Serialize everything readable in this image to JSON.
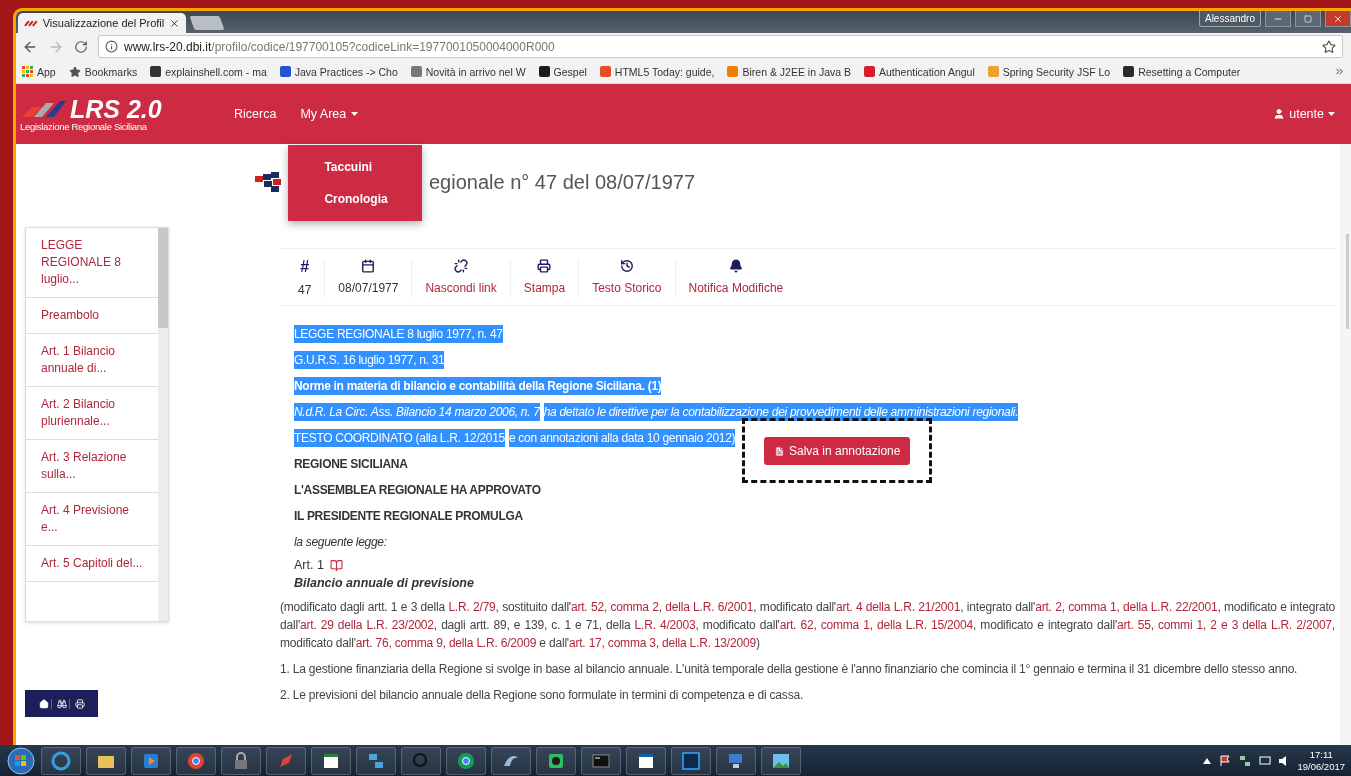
{
  "browser": {
    "tab": {
      "title": "Visualizzazione del Profil"
    },
    "profile": "Alessandro",
    "url": {
      "host": "www.lrs-20.dbi.it",
      "path": "/profilo/codice/197700105?codiceLink=1977001050004000R000"
    },
    "bookmarks": [
      {
        "label": "App",
        "kind": "apps"
      },
      {
        "label": "Bookmarks",
        "kind": "star"
      },
      {
        "label": "explainshell.com - ma",
        "kind": "site",
        "color": "#333333"
      },
      {
        "label": "Java Practices -> Cho",
        "kind": "site",
        "color": "#2255cc"
      },
      {
        "label": "Novità in arrivo nel W",
        "kind": "site",
        "color": "#777777"
      },
      {
        "label": "Gespel",
        "kind": "site",
        "color": "#1a1a1a"
      },
      {
        "label": "HTML5 Today: guide,",
        "kind": "site",
        "color": "#e44d26"
      },
      {
        "label": "Biren & J2EE in Java B",
        "kind": "site",
        "color": "#f57d00"
      },
      {
        "label": "Authentication Angul",
        "kind": "site",
        "color": "#d21f2a"
      },
      {
        "label": "Spring Security JSF Lo",
        "kind": "site",
        "color": "#f0a030"
      },
      {
        "label": "Resetting a Computer",
        "kind": "site",
        "color": "#2a2a2a"
      }
    ]
  },
  "navbar": {
    "logo": {
      "title": "LRS 2.0",
      "subtitle": "Legislazione Regionale Siciliana"
    },
    "items": [
      {
        "label": "Ricerca"
      },
      {
        "label": "My Area",
        "menu": [
          "Taccuini",
          "Cronologia"
        ]
      }
    ],
    "user": "utente"
  },
  "sidebar": {
    "items": [
      "LEGGE REGIONALE 8 luglio...",
      "Preambolo",
      "Art. 1 Bilancio annuale di...",
      "Art. 2 Bilancio pluriennale...",
      "Art. 3 Relazione sulla...",
      "Art. 4 Previsione e...",
      "Art. 5 Capitoli del..."
    ]
  },
  "document": {
    "title": "egionale n° 47 del 08/07/1977",
    "toolbar": [
      {
        "kind": "number",
        "symbol": "#",
        "label": "47",
        "link": false
      },
      {
        "kind": "date",
        "label": "08/07/1977",
        "link": false
      },
      {
        "kind": "unlink",
        "label": "Nascondi link",
        "link": true
      },
      {
        "kind": "print",
        "label": "Stampa",
        "link": true
      },
      {
        "kind": "history",
        "label": "Testo Storico",
        "link": true
      },
      {
        "kind": "bell",
        "label": "Notifica Modifiche",
        "link": true
      }
    ],
    "lines": [
      {
        "kind": "reference",
        "highlighted": true,
        "segments": [
          "LEGGE REGIONALE 8 luglio 1977, n. 47"
        ]
      },
      {
        "kind": "reference",
        "highlighted": true,
        "segments": [
          "G.U.R.S. 16 luglio 1977, n. 31"
        ]
      },
      {
        "kind": "subject",
        "highlighted": true,
        "segments": [
          "Norme in materia di bilancio e contabilità della Regione Siciliana. (1)"
        ]
      },
      {
        "kind": "note",
        "highlighted": true,
        "segments": [
          "N.d.R. La Circ. Ass. Bilancio 14 marzo 2006, n. 7",
          "ha dettato le direttive per la contabilizzazione dei provvedimenti delle amministrazioni regionali."
        ]
      },
      {
        "kind": "reference",
        "highlighted": true,
        "segments": [
          "TESTO COORDINATO (alla L.R. 12/2015",
          "e con annotazioni alla data 10 gennaio 2012)"
        ]
      },
      {
        "kind": "heading",
        "highlighted": false,
        "segments": [
          "REGIONE SICILIANA"
        ]
      },
      {
        "kind": "heading",
        "highlighted": false,
        "segments": [
          "L'ASSEMBLEA REGIONALE HA APPROVATO"
        ]
      },
      {
        "kind": "heading",
        "highlighted": false,
        "segments": [
          "IL PRESIDENTE REGIONALE PROMULGA"
        ]
      },
      {
        "kind": "formula",
        "highlighted": false,
        "segments": [
          "la seguente legge:"
        ]
      }
    ],
    "save_button": "Salva in annotazione",
    "article": {
      "number": "Art. 1",
      "title": "Bilancio annuale di previsione",
      "note": [
        {
          "text": "(modificato dagli artt. 1 e 3 della ",
          "kind": "text"
        },
        {
          "text": "L.R. 2/79",
          "kind": "link"
        },
        {
          "text": ", sostituito dall'",
          "kind": "text"
        },
        {
          "text": "art. 52, comma 2, della L.R. 6/2001",
          "kind": "link"
        },
        {
          "text": ", modificato dall'",
          "kind": "text"
        },
        {
          "text": "art. 4 della L.R. 21/2001",
          "kind": "link"
        },
        {
          "text": ", integrato dall'",
          "kind": "text"
        },
        {
          "text": "art. 2, comma 1, della L.R.",
          "kind": "link"
        },
        {
          "text": "22/2001",
          "kind": "link"
        },
        {
          "text": ", modificato e integrato dall'",
          "kind": "text"
        },
        {
          "text": "art. 29 della L.R. 23/2002",
          "kind": "link"
        },
        {
          "text": ", dagli artt. 89, e 139, c. 1 e 71, della ",
          "kind": "text"
        },
        {
          "text": "L.R. 4/2003",
          "kind": "link"
        },
        {
          "text": ", modificato dall'",
          "kind": "text"
        },
        {
          "text": "art. 62, comma 1, della L.R. 15/2004",
          "kind": "link"
        },
        {
          "text": ", modificato e integrato dall'",
          "kind": "text"
        },
        {
          "text": "art. 55, commi 1, 2 e 3 della L.R. 2/2007",
          "kind": "link"
        },
        {
          "text": ", modificato dall'",
          "kind": "text"
        },
        {
          "text": "art. 76, comma 9, della L.R. 6/2009",
          "kind": "link"
        },
        {
          "text": " e dall'",
          "kind": "text"
        },
        {
          "text": "art. 17, comma 3, della L.R. 13/2009",
          "kind": "link"
        },
        {
          "text": ")",
          "kind": "text"
        }
      ],
      "paragraphs": [
        "1. La gestione finanziaria della Regione si svolge in base al bilancio annuale. L'unità temporale della gestione è l'anno finanziario che comincia il 1° gennaio e termina il 31 dicembre dello stesso anno.",
        "2. Le previsioni del bilancio annuale della Regione sono formulate in termini di competenza e di cassa."
      ]
    }
  },
  "taskbar": {
    "time": "17:11",
    "date": "19/06/2017"
  }
}
